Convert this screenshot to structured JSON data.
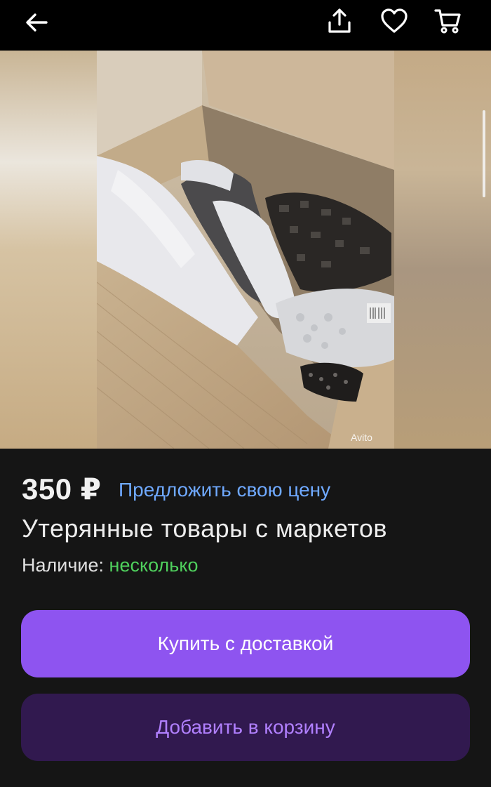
{
  "topbar": {
    "back_icon": "arrow-left-icon",
    "share_icon": "share-icon",
    "favorite_icon": "heart-icon",
    "cart_icon": "cart-icon"
  },
  "gallery": {
    "watermark": "Avito"
  },
  "listing": {
    "price": "350 ₽",
    "offer_link": "Предложить свою цену",
    "title": "Утерянные товары с маркетов",
    "availability_label": "Наличие:",
    "availability_value": "несколько"
  },
  "actions": {
    "buy_label": "Купить с доставкой",
    "cart_label": "Добавить в корзину"
  },
  "colors": {
    "accent": "#8e54f0",
    "accent_dark": "#31194f",
    "link": "#6fa9ff",
    "in_stock": "#4fd15d",
    "background": "#151515"
  }
}
